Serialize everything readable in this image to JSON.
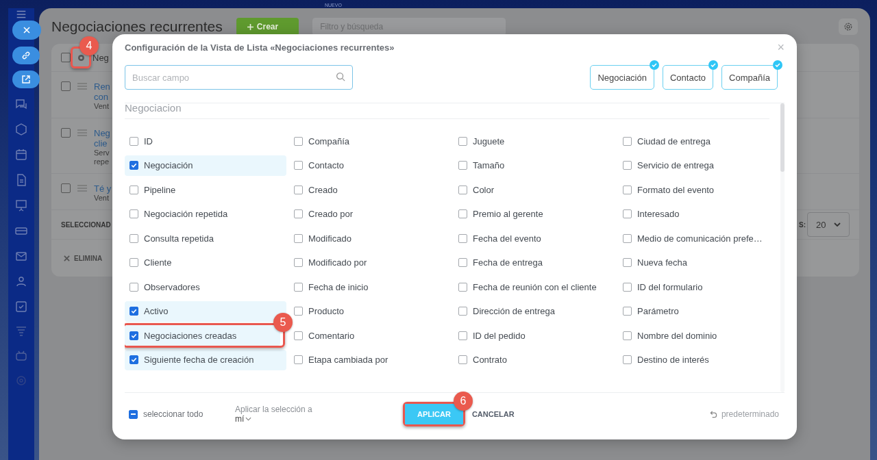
{
  "top_bar": {
    "badge": "NUEVO"
  },
  "page": {
    "title": "Negociaciones recurrentes",
    "create_button": "Crear",
    "search": {
      "placeholder": "Filtro y búsqueda"
    }
  },
  "table": {
    "header": "Neg",
    "header_checked": false,
    "settings_callout": "4",
    "rows": [
      {
        "checked": false,
        "title": [
          "Ren",
          "con"
        ],
        "subtitle": [
          "Vent"
        ]
      },
      {
        "checked": false,
        "title": [
          "Neg",
          "clie"
        ],
        "subtitle": [
          "Serv",
          "repe"
        ]
      },
      {
        "checked": false,
        "title": [
          "Té y"
        ],
        "subtitle": [
          "Vent"
        ]
      }
    ],
    "selected_label": "SELECCIONAD",
    "delete_label": "ELIMINA",
    "page_size_label": "S:",
    "page_size": "20"
  },
  "dialog": {
    "title": "Configuración de la Vista de Lista «Negociaciones recurrentes»",
    "close": "×",
    "search": {
      "placeholder": "Buscar campo"
    },
    "entities": [
      {
        "label": "Negociación",
        "selected": true
      },
      {
        "label": "Contacto",
        "selected": true
      },
      {
        "label": "Compañía",
        "selected": true
      }
    ],
    "section": "Negociacion",
    "columns": [
      [
        {
          "label": "ID",
          "checked": false
        },
        {
          "label": "Negociación",
          "checked": true
        },
        {
          "label": "Pipeline",
          "checked": false
        },
        {
          "label": "Negociación repetida",
          "checked": false
        },
        {
          "label": "Consulta repetida",
          "checked": false
        },
        {
          "label": "Cliente",
          "checked": false
        },
        {
          "label": "Observadores",
          "checked": false
        },
        {
          "label": "Activo",
          "checked": true
        },
        {
          "label": "Negociaciones creadas",
          "checked": true,
          "callout": "5"
        },
        {
          "label": "Siguiente fecha de creación",
          "checked": true
        }
      ],
      [
        {
          "label": "Compañía",
          "checked": false
        },
        {
          "label": "Contacto",
          "checked": false
        },
        {
          "label": "Creado",
          "checked": false
        },
        {
          "label": "Creado por",
          "checked": false
        },
        {
          "label": "Modificado",
          "checked": false
        },
        {
          "label": "Modificado por",
          "checked": false
        },
        {
          "label": "Fecha de inicio",
          "checked": false
        },
        {
          "label": "Producto",
          "checked": false
        },
        {
          "label": "Comentario",
          "checked": false
        },
        {
          "label": "Etapa cambiada por",
          "checked": false
        }
      ],
      [
        {
          "label": "Juguete",
          "checked": false
        },
        {
          "label": "Tamaño",
          "checked": false
        },
        {
          "label": "Color",
          "checked": false
        },
        {
          "label": "Premio al gerente",
          "checked": false
        },
        {
          "label": "Fecha del evento",
          "checked": false
        },
        {
          "label": "Fecha de entrega",
          "checked": false
        },
        {
          "label": "Fecha de reunión con el cliente",
          "checked": false
        },
        {
          "label": "Dirección de entrega",
          "checked": false
        },
        {
          "label": "ID del pedido",
          "checked": false
        },
        {
          "label": "Contrato",
          "checked": false
        }
      ],
      [
        {
          "label": "Ciudad de entrega",
          "checked": false
        },
        {
          "label": "Servicio de entrega",
          "checked": false
        },
        {
          "label": "Formato del evento",
          "checked": false
        },
        {
          "label": "Interesado",
          "checked": false
        },
        {
          "label": "Medio de comunicación prefe…",
          "checked": false
        },
        {
          "label": "Nueva fecha",
          "checked": false
        },
        {
          "label": "ID del formulario",
          "checked": false
        },
        {
          "label": "Parámetro",
          "checked": false
        },
        {
          "label": "Nombre del dominio",
          "checked": false
        },
        {
          "label": "Destino de interés",
          "checked": false
        }
      ]
    ],
    "select_all": {
      "label": "seleccionar todo",
      "indeterminate": true
    },
    "apply_to": {
      "label": "Aplicar la selección a",
      "value": "mí"
    },
    "apply_button": {
      "label": "APLICAR",
      "callout": "6"
    },
    "cancel_button": "CANCELAR",
    "reset": "predeterminado"
  }
}
